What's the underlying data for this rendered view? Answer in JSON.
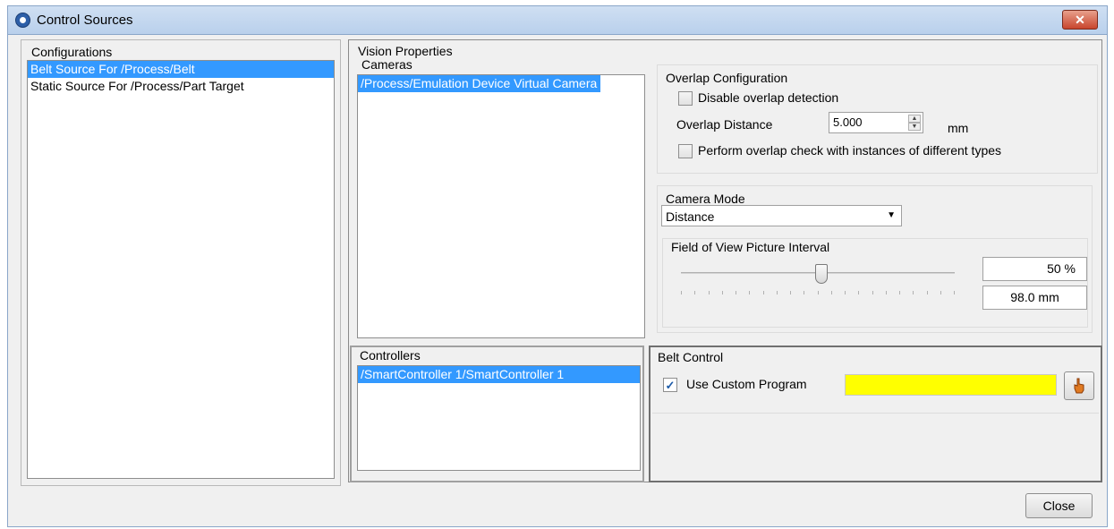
{
  "window": {
    "title": "Control Sources",
    "close_glyph": "✕"
  },
  "configurations": {
    "label": "Configurations",
    "items": [
      {
        "label": "Belt Source For /Process/Belt",
        "selected": true
      },
      {
        "label": "Static Source For /Process/Part Target",
        "selected": false
      }
    ]
  },
  "vision": {
    "label": "Vision Properties",
    "cameras": {
      "label": "Cameras",
      "items": [
        {
          "label": "/Process/Emulation Device Virtual Camera",
          "selected": true
        }
      ]
    }
  },
  "overlap": {
    "label": "Overlap Configuration",
    "disable_label": "Disable overlap detection",
    "disable_checked": false,
    "distance_label": "Overlap Distance",
    "distance_value": "5.000",
    "distance_unit": "mm",
    "different_types_label": "Perform overlap check with instances of different types",
    "different_types_checked": false
  },
  "camera_mode": {
    "label": "Camera Mode",
    "selected": "Distance",
    "fov": {
      "label": "Field of View Picture Interval",
      "slider_percent": 50,
      "percent_text": "50 %",
      "distance_text": "98.0 mm"
    }
  },
  "controllers": {
    "label": "Controllers",
    "items": [
      {
        "label": "/SmartController 1/SmartController 1",
        "selected": true
      }
    ]
  },
  "belt_control": {
    "label": "Belt Control",
    "custom_program_label": "Use Custom Program",
    "custom_program_checked": true,
    "check_glyph": "✓",
    "program_value": "",
    "program_field_color": "#ffff00",
    "picker_icon": "hand-pointer-icon"
  },
  "footer": {
    "close_label": "Close"
  },
  "colors": {
    "selection": "#3399ff",
    "window_bg": "#f0f0f0"
  }
}
